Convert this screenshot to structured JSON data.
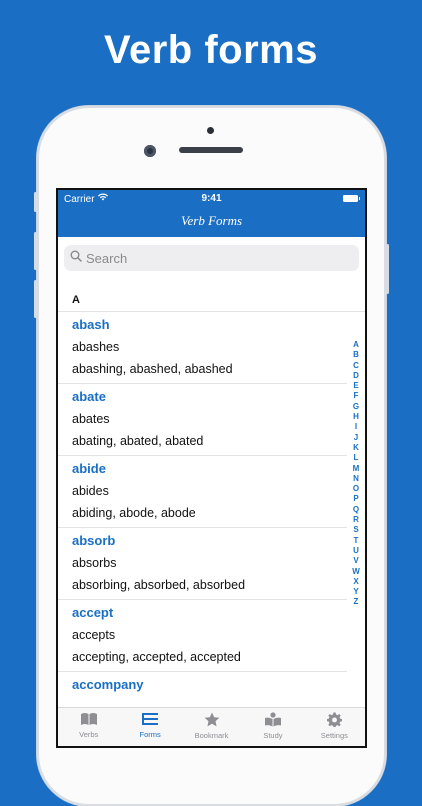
{
  "promo": {
    "title": "Verb forms"
  },
  "status": {
    "carrier": "Carrier",
    "time": "9:41"
  },
  "nav": {
    "title": "Verb Forms"
  },
  "search": {
    "placeholder": "Search"
  },
  "section": {
    "letter": "A"
  },
  "entries": [
    {
      "base": "abash",
      "third": "abashes",
      "rest": "abashing, abashed, abashed"
    },
    {
      "base": "abate",
      "third": "abates",
      "rest": "abating, abated, abated"
    },
    {
      "base": "abide",
      "third": "abides",
      "rest": "abiding, abode, abode"
    },
    {
      "base": "absorb",
      "third": "absorbs",
      "rest": "absorbing, absorbed, absorbed"
    },
    {
      "base": "accept",
      "third": "accepts",
      "rest": "accepting, accepted, accepted"
    },
    {
      "base": "accompany",
      "third": "",
      "rest": ""
    }
  ],
  "index_letters": [
    "A",
    "B",
    "C",
    "D",
    "E",
    "F",
    "G",
    "H",
    "I",
    "J",
    "K",
    "L",
    "M",
    "N",
    "O",
    "P",
    "Q",
    "R",
    "S",
    "T",
    "U",
    "V",
    "W",
    "X",
    "Y",
    "Z"
  ],
  "tabs": [
    {
      "label": "Verbs",
      "icon": "book-icon"
    },
    {
      "label": "Forms",
      "icon": "list-icon"
    },
    {
      "label": "Bookmark",
      "icon": "star-icon"
    },
    {
      "label": "Study",
      "icon": "reader-icon"
    },
    {
      "label": "Settings",
      "icon": "gear-icon"
    }
  ],
  "colors": {
    "accent": "#1a6fc4",
    "inactive": "#8e8e93"
  }
}
